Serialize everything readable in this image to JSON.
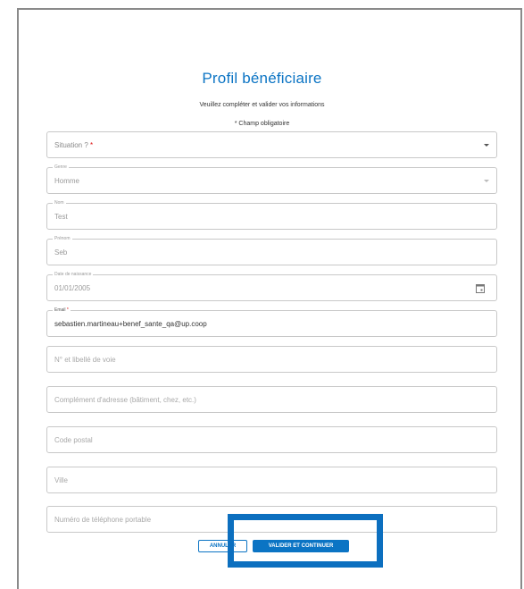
{
  "form": {
    "title": "Profil bénéficiaire",
    "subtitle": "Veuillez compléter et valider vos informations",
    "required_note": "* Champ obligatoire",
    "situation": {
      "placeholder": "Situation ?",
      "required_mark": "*"
    },
    "genre": {
      "label": "Genre",
      "value": "Homme"
    },
    "nom": {
      "label": "Nom",
      "value": "Test"
    },
    "prenom": {
      "label": "Prénom",
      "value": "Seb"
    },
    "date_naissance": {
      "label": "Date de naissance",
      "value": "01/01/2005"
    },
    "email": {
      "label": "Email",
      "required_mark": "*",
      "value": "sebastien.martineau+benef_sante_qa@up.coop"
    },
    "voie": {
      "placeholder": "N° et libellé de voie"
    },
    "complement": {
      "placeholder": "Complément d'adresse (bâtiment, chez, etc.)"
    },
    "code_postal": {
      "placeholder": "Code postal"
    },
    "ville": {
      "placeholder": "Ville"
    },
    "telephone": {
      "placeholder": "Numéro de téléphone portable"
    }
  },
  "actions": {
    "cancel_label": "ANNULER",
    "submit_label": "VALIDER ET CONTINUER"
  },
  "colors": {
    "primary": "#0b74c4",
    "required": "#dd1111",
    "highlight": "#0c6fbf"
  },
  "icons": [
    "dropdown-arrow-icon",
    "calendar-icon"
  ]
}
